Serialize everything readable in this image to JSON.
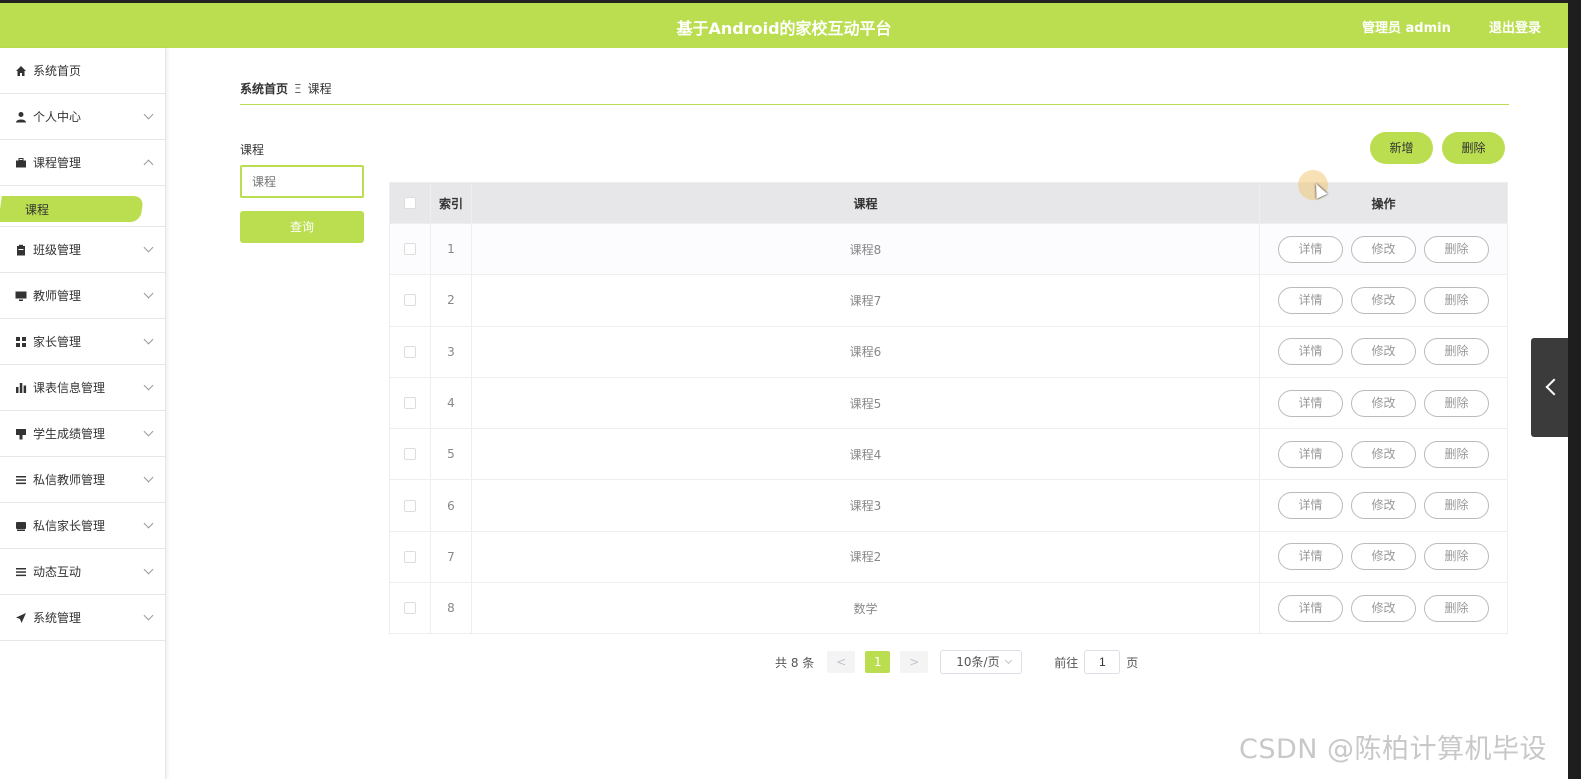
{
  "header": {
    "title": "基于Android的家校互动平台",
    "user": "管理员 admin",
    "logout": "退出登录",
    "accent": "#bade50"
  },
  "sidebar": {
    "items": [
      {
        "label": "系统首页",
        "icon": "home-icon",
        "chevron": false
      },
      {
        "label": "个人中心",
        "icon": "person-icon",
        "chevron": true
      },
      {
        "label": "课程管理",
        "icon": "briefcase-icon",
        "chevron": true,
        "expanded": true
      },
      {
        "label": "班级管理",
        "icon": "clipboard-icon",
        "chevron": true
      },
      {
        "label": "教师管理",
        "icon": "monitor-icon",
        "chevron": true
      },
      {
        "label": "家长管理",
        "icon": "grid-icon",
        "chevron": true
      },
      {
        "label": "课表信息管理",
        "icon": "bar-chart-icon",
        "chevron": true
      },
      {
        "label": "学生成绩管理",
        "icon": "flag-icon",
        "chevron": true
      },
      {
        "label": "私信教师管理",
        "icon": "list-icon",
        "chevron": true
      },
      {
        "label": "私信家长管理",
        "icon": "tray-icon",
        "chevron": true
      },
      {
        "label": "动态互动",
        "icon": "list-icon",
        "chevron": true
      },
      {
        "label": "系统管理",
        "icon": "send-icon",
        "chevron": true
      }
    ],
    "submenu_active": "课程"
  },
  "breadcrumb": {
    "home": "系统首页",
    "separator": "Ξ",
    "current": "课程"
  },
  "search": {
    "label": "课程",
    "placeholder": "课程",
    "button": "查询"
  },
  "actions": {
    "add": "新增",
    "delete": "删除"
  },
  "table": {
    "headers": {
      "index": "索引",
      "course": "课程",
      "ops": "操作"
    },
    "op_labels": {
      "detail": "详情",
      "edit": "修改",
      "delete": "删除"
    },
    "rows": [
      {
        "index": "1",
        "course": "课程8"
      },
      {
        "index": "2",
        "course": "课程7"
      },
      {
        "index": "3",
        "course": "课程6"
      },
      {
        "index": "4",
        "course": "课程5"
      },
      {
        "index": "5",
        "course": "课程4"
      },
      {
        "index": "6",
        "course": "课程3"
      },
      {
        "index": "7",
        "course": "课程2"
      },
      {
        "index": "8",
        "course": "数学"
      }
    ]
  },
  "pagination": {
    "total": "共 8 条",
    "prev": "<",
    "current_page": "1",
    "next": ">",
    "page_size": "10条/页",
    "goto_prefix": "前往",
    "goto_value": "1",
    "goto_suffix": "页"
  },
  "watermark": "CSDN @陈柏计算机毕设"
}
